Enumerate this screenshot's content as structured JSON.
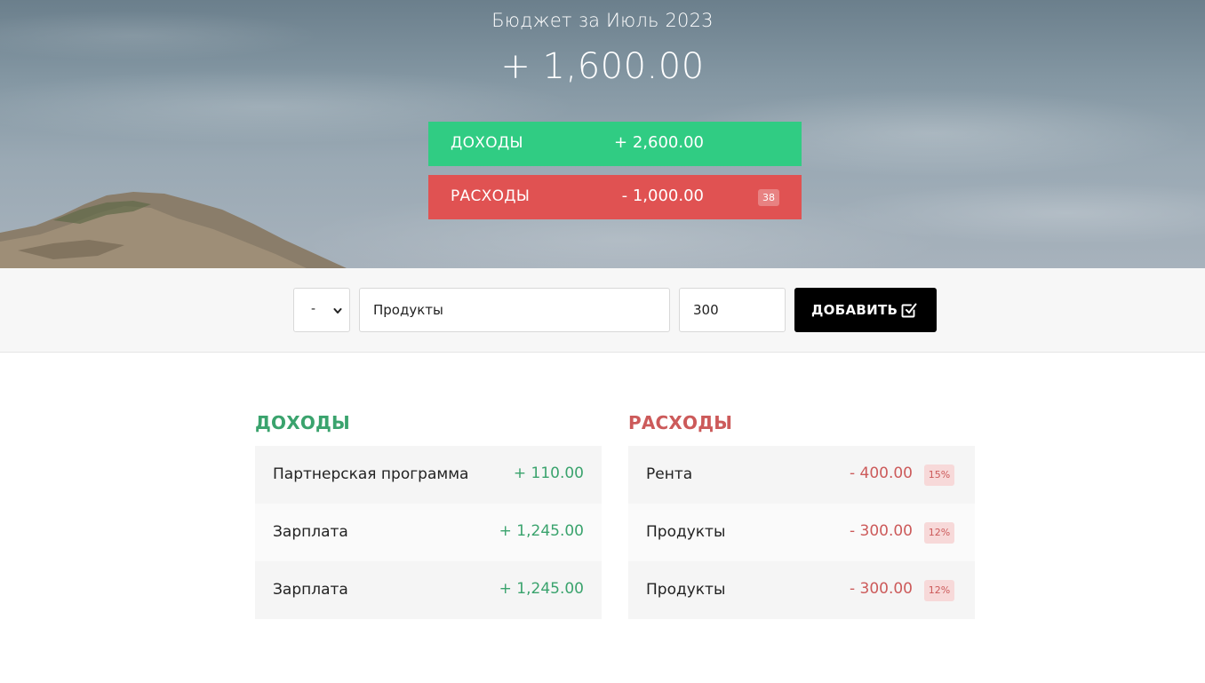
{
  "header": {
    "title": "Бюджет за Июль 2023",
    "total": "+ 1,600.00",
    "income": {
      "label": "Доходы",
      "value": "+ 2,600.00"
    },
    "expense": {
      "label": "Расходы",
      "value": "- 1,000.00",
      "percent": "38"
    }
  },
  "add_form": {
    "type_value": "-",
    "description_value": "Продукты",
    "amount_value": "300",
    "button_label": "Добавить",
    "button_icon": "checkbox-check-icon"
  },
  "income_list": {
    "title": "Доходы",
    "items": [
      {
        "description": "Партнерская программа",
        "value": "+ 110.00"
      },
      {
        "description": "Зарплата",
        "value": "+ 1,245.00"
      },
      {
        "description": "Зарплата",
        "value": "+ 1,245.00"
      }
    ]
  },
  "expense_list": {
    "title": "Расходы",
    "items": [
      {
        "description": "Рента",
        "value": "- 400.00",
        "percent": "15%"
      },
      {
        "description": "Продукты",
        "value": "- 300.00",
        "percent": "12%"
      },
      {
        "description": "Продукты",
        "value": "- 300.00",
        "percent": "12%"
      }
    ]
  },
  "colors": {
    "income_bar": "#30cc83",
    "expense_bar": "#e05252",
    "income_text": "#3aa36d",
    "expense_text": "#cc5a5a",
    "button": "#000000"
  }
}
